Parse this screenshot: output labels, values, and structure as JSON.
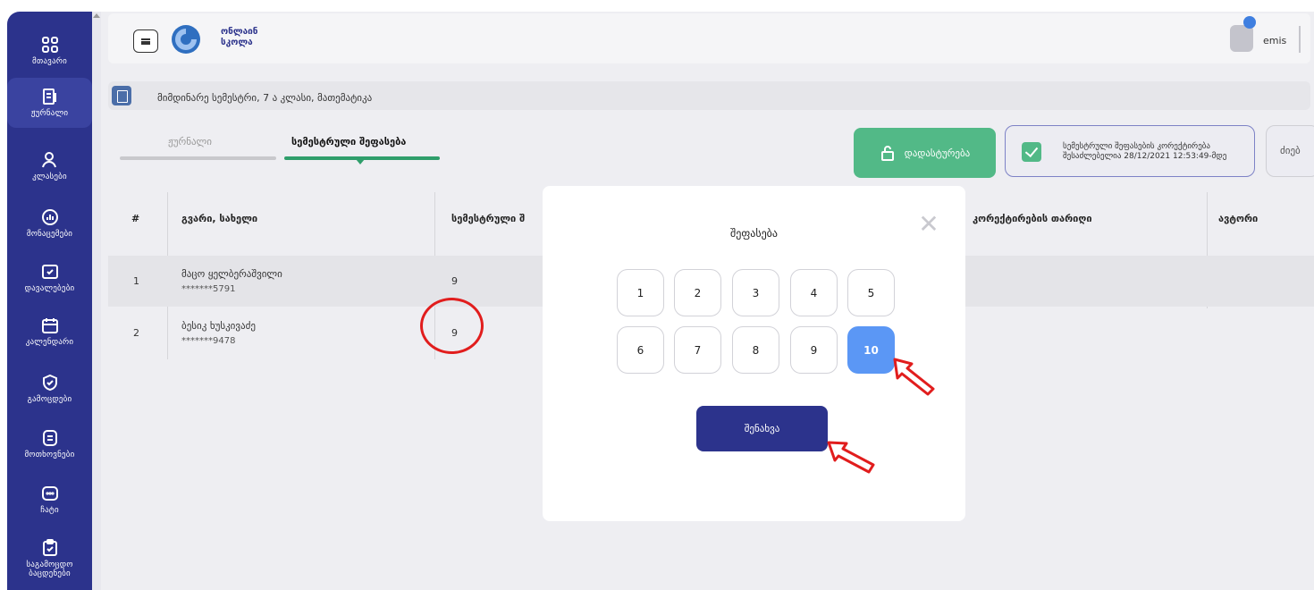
{
  "sidebar": {
    "items": [
      {
        "label": "მთავარი",
        "icon": "grid-icon"
      },
      {
        "label": "ჟურნალი",
        "icon": "journal-icon"
      },
      {
        "label": "კლასები",
        "icon": "users-icon"
      },
      {
        "label": "მონაცემები",
        "icon": "chart-icon"
      },
      {
        "label": "დავალებები",
        "icon": "task-icon"
      },
      {
        "label": "კალენდარი",
        "icon": "calendar-icon"
      },
      {
        "label": "გამოცდები",
        "icon": "shield-icon"
      },
      {
        "label": "მოთხოვნები",
        "icon": "document-icon"
      },
      {
        "label": "ჩატი",
        "icon": "chat-icon"
      },
      {
        "label": "საგამოცდო\nბაცდენები",
        "icon": "clipboard-icon"
      }
    ]
  },
  "header": {
    "brand_line1": "ონლაინ",
    "brand_line2": "სკოლა",
    "user": "emis"
  },
  "breadcrumb": "მიმდინარე სემესტრი, 7 ა კლასი, მათემატიკა",
  "tabs": {
    "journal": "ჟურნალი",
    "semester_grade": "სემესტრული შეფასება"
  },
  "actions": {
    "confirm": "დადასტურება",
    "notice_line1": "სემესტრული შეფასების კორექტირება",
    "notice_line2": "შესაძლებელია 28/12/2021 12:53:49-მდე",
    "more": "ძიებ"
  },
  "table": {
    "headers": {
      "num": "#",
      "name": "გვარი, სახელი",
      "semester": "სემესტრული შ",
      "correction_date": "კორექტირების თარიღი",
      "author": "ავტორი"
    },
    "rows": [
      {
        "num": "1",
        "name": "მაცო ყელბერაშვილი",
        "id": "*******5791",
        "grade": "9"
      },
      {
        "num": "2",
        "name": "ბესიკ ხუსკივაძე",
        "id": "*******9478",
        "grade": "9"
      }
    ]
  },
  "modal": {
    "title": "შეფასება",
    "grades": [
      "1",
      "2",
      "3",
      "4",
      "5",
      "6",
      "7",
      "8",
      "9",
      "10"
    ],
    "selected": "10",
    "save": "შენახვა"
  },
  "colors": {
    "sidebar": "#2c338c",
    "accent_green": "#52b987",
    "selected_grade": "#5b97f5",
    "annotation_red": "#e11d1d"
  }
}
